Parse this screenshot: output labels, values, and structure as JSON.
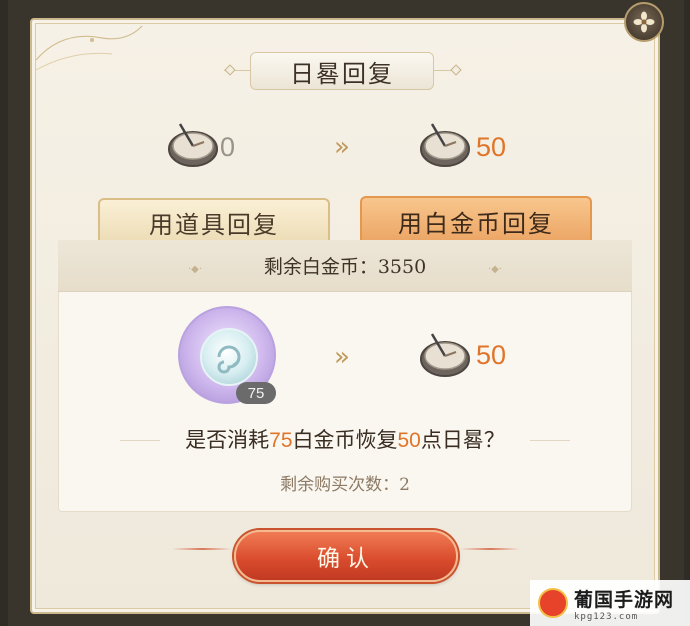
{
  "dialog": {
    "title": "日晷回复",
    "current_value": "0",
    "target_value": "50",
    "arrow_glyph": "»"
  },
  "tabs": [
    {
      "label": "用道具回复",
      "selected": false
    },
    {
      "label": "用白金币回复",
      "selected": true
    }
  ],
  "panel": {
    "remaining_label": "剩余白金币：3550",
    "cost_quantity": "75",
    "reward_value": "50",
    "question_prefix": "是否消耗",
    "question_cost": "75",
    "question_mid": "白金币恢复",
    "question_reward": "50",
    "question_suffix": "点日晷？",
    "purchases_left": "剩余购买次数：2",
    "confirm_label": "确认"
  },
  "watermark": {
    "title": "葡国手游网",
    "url": "kpg123.com"
  },
  "colors": {
    "accent_orange": "#e0752a",
    "confirm_red": "#d84a2c",
    "tab_selected": "#eba463"
  }
}
